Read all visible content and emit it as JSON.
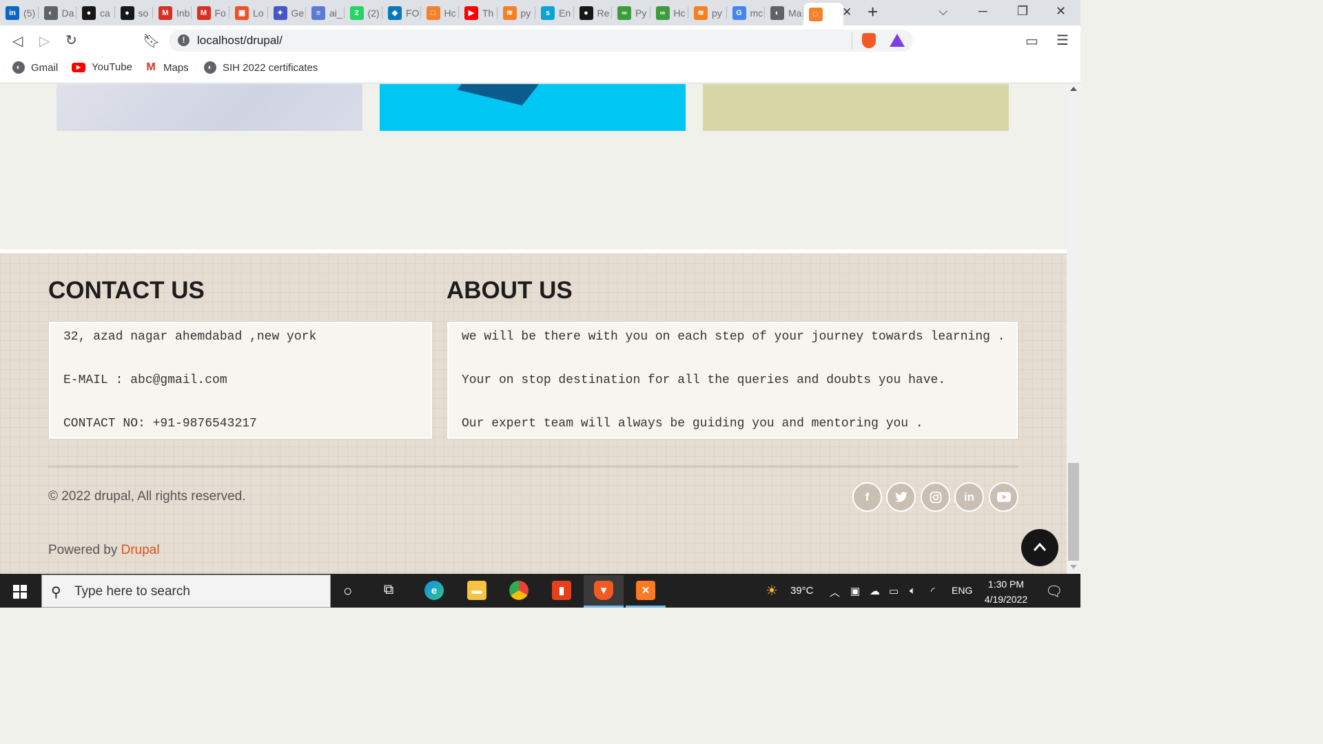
{
  "browser": {
    "tabs": [
      {
        "label": "(5)",
        "icon": "linkedin-icon",
        "color": "#0a66c2",
        "glyph": "in"
      },
      {
        "label": "Da",
        "icon": "globe-icon",
        "color": "#5f6368",
        "glyph": "◐"
      },
      {
        "label": "ca",
        "icon": "github-icon",
        "color": "#181717",
        "glyph": "●"
      },
      {
        "label": "so",
        "icon": "github-icon",
        "color": "#181717",
        "glyph": "●"
      },
      {
        "label": "Inb",
        "icon": "gmail-icon",
        "color": "#d93025",
        "glyph": "M"
      },
      {
        "label": "Fo",
        "icon": "gmail-icon",
        "color": "#d93025",
        "glyph": "M"
      },
      {
        "label": "Lo",
        "icon": "microsoft-icon",
        "color": "#f25022",
        "glyph": "▦"
      },
      {
        "label": "Ge",
        "icon": "gear-icon",
        "color": "#4756c4",
        "glyph": "✦"
      },
      {
        "label": "ai_",
        "icon": "server-icon",
        "color": "#5b7bd5",
        "glyph": "≡"
      },
      {
        "label": "(2)",
        "icon": "whatsapp-icon",
        "color": "#25d366",
        "glyph": "2"
      },
      {
        "label": "FO",
        "icon": "drupal-icon",
        "color": "#0678be",
        "glyph": "◆"
      },
      {
        "label": "Hc",
        "icon": "orange-square-icon",
        "color": "#f5822a",
        "glyph": "□"
      },
      {
        "label": "Th",
        "icon": "youtube-icon",
        "color": "#ff0000",
        "glyph": "▶"
      },
      {
        "label": "py",
        "icon": "stackoverflow-icon",
        "color": "#f48024",
        "glyph": "≋"
      },
      {
        "label": "En",
        "icon": "spacy-icon",
        "color": "#09a3d5",
        "glyph": "s"
      },
      {
        "label": "Re",
        "icon": "github-icon",
        "color": "#181717",
        "glyph": "●"
      },
      {
        "label": "Py",
        "icon": "infinity-icon",
        "color": "#3a9c3a",
        "glyph": "∞"
      },
      {
        "label": "Hc",
        "icon": "infinity-icon",
        "color": "#3a9c3a",
        "glyph": "∞"
      },
      {
        "label": "py",
        "icon": "stackoverflow-icon",
        "color": "#f48024",
        "glyph": "≋"
      },
      {
        "label": "mc",
        "icon": "google-icon",
        "color": "#4285f4",
        "glyph": "G"
      },
      {
        "label": "Ma",
        "icon": "globe-icon",
        "color": "#5f6368",
        "glyph": "◐"
      },
      {
        "label": "",
        "icon": "orange-square-icon",
        "color": "#f5822a",
        "glyph": "□",
        "active": true
      }
    ],
    "url": "localhost/drupal/",
    "bookmarks": [
      {
        "label": "Gmail",
        "icon": "globe-icon",
        "color": "#5f6368",
        "glyph": "◐"
      },
      {
        "label": "YouTube",
        "icon": "youtube-icon",
        "color": "#ff0000",
        "glyph": "▶"
      },
      {
        "label": "Maps",
        "icon": "gmail-icon",
        "color": "#d93025",
        "glyph": "M"
      },
      {
        "label": "SIH 2022 certificates",
        "icon": "globe-icon",
        "color": "#5f6368",
        "glyph": "◐"
      }
    ]
  },
  "footer": {
    "contact_heading": "CONTACT US",
    "contact_lines": [
      "32, azad nagar ahemdabad ,new york",
      "E-MAIL : abc@gmail.com",
      "CONTACT NO: +91-9876543217"
    ],
    "about_heading": "ABOUT US",
    "about_lines": [
      "we will be there with you on each step of your journey towards learning .",
      "Your on stop destination for all the queries and doubts you have.",
      "Our expert team will always be guiding you and mentoring you ."
    ],
    "copyright": "© 2022 drupal, All rights reserved.",
    "powered_prefix": "Powered by",
    "powered_link": "Drupal",
    "social": [
      {
        "name": "facebook-icon",
        "glyph": "f"
      },
      {
        "name": "twitter-icon",
        "glyph": "🐦"
      },
      {
        "name": "instagram-icon",
        "glyph": "◎"
      },
      {
        "name": "linkedin-icon",
        "glyph": "in"
      },
      {
        "name": "youtube-icon",
        "glyph": "▶"
      }
    ]
  },
  "taskbar": {
    "search_placeholder": "Type here to search",
    "weather": "39°C",
    "language": "ENG",
    "time": "1:30 PM",
    "date": "4/19/2022"
  }
}
